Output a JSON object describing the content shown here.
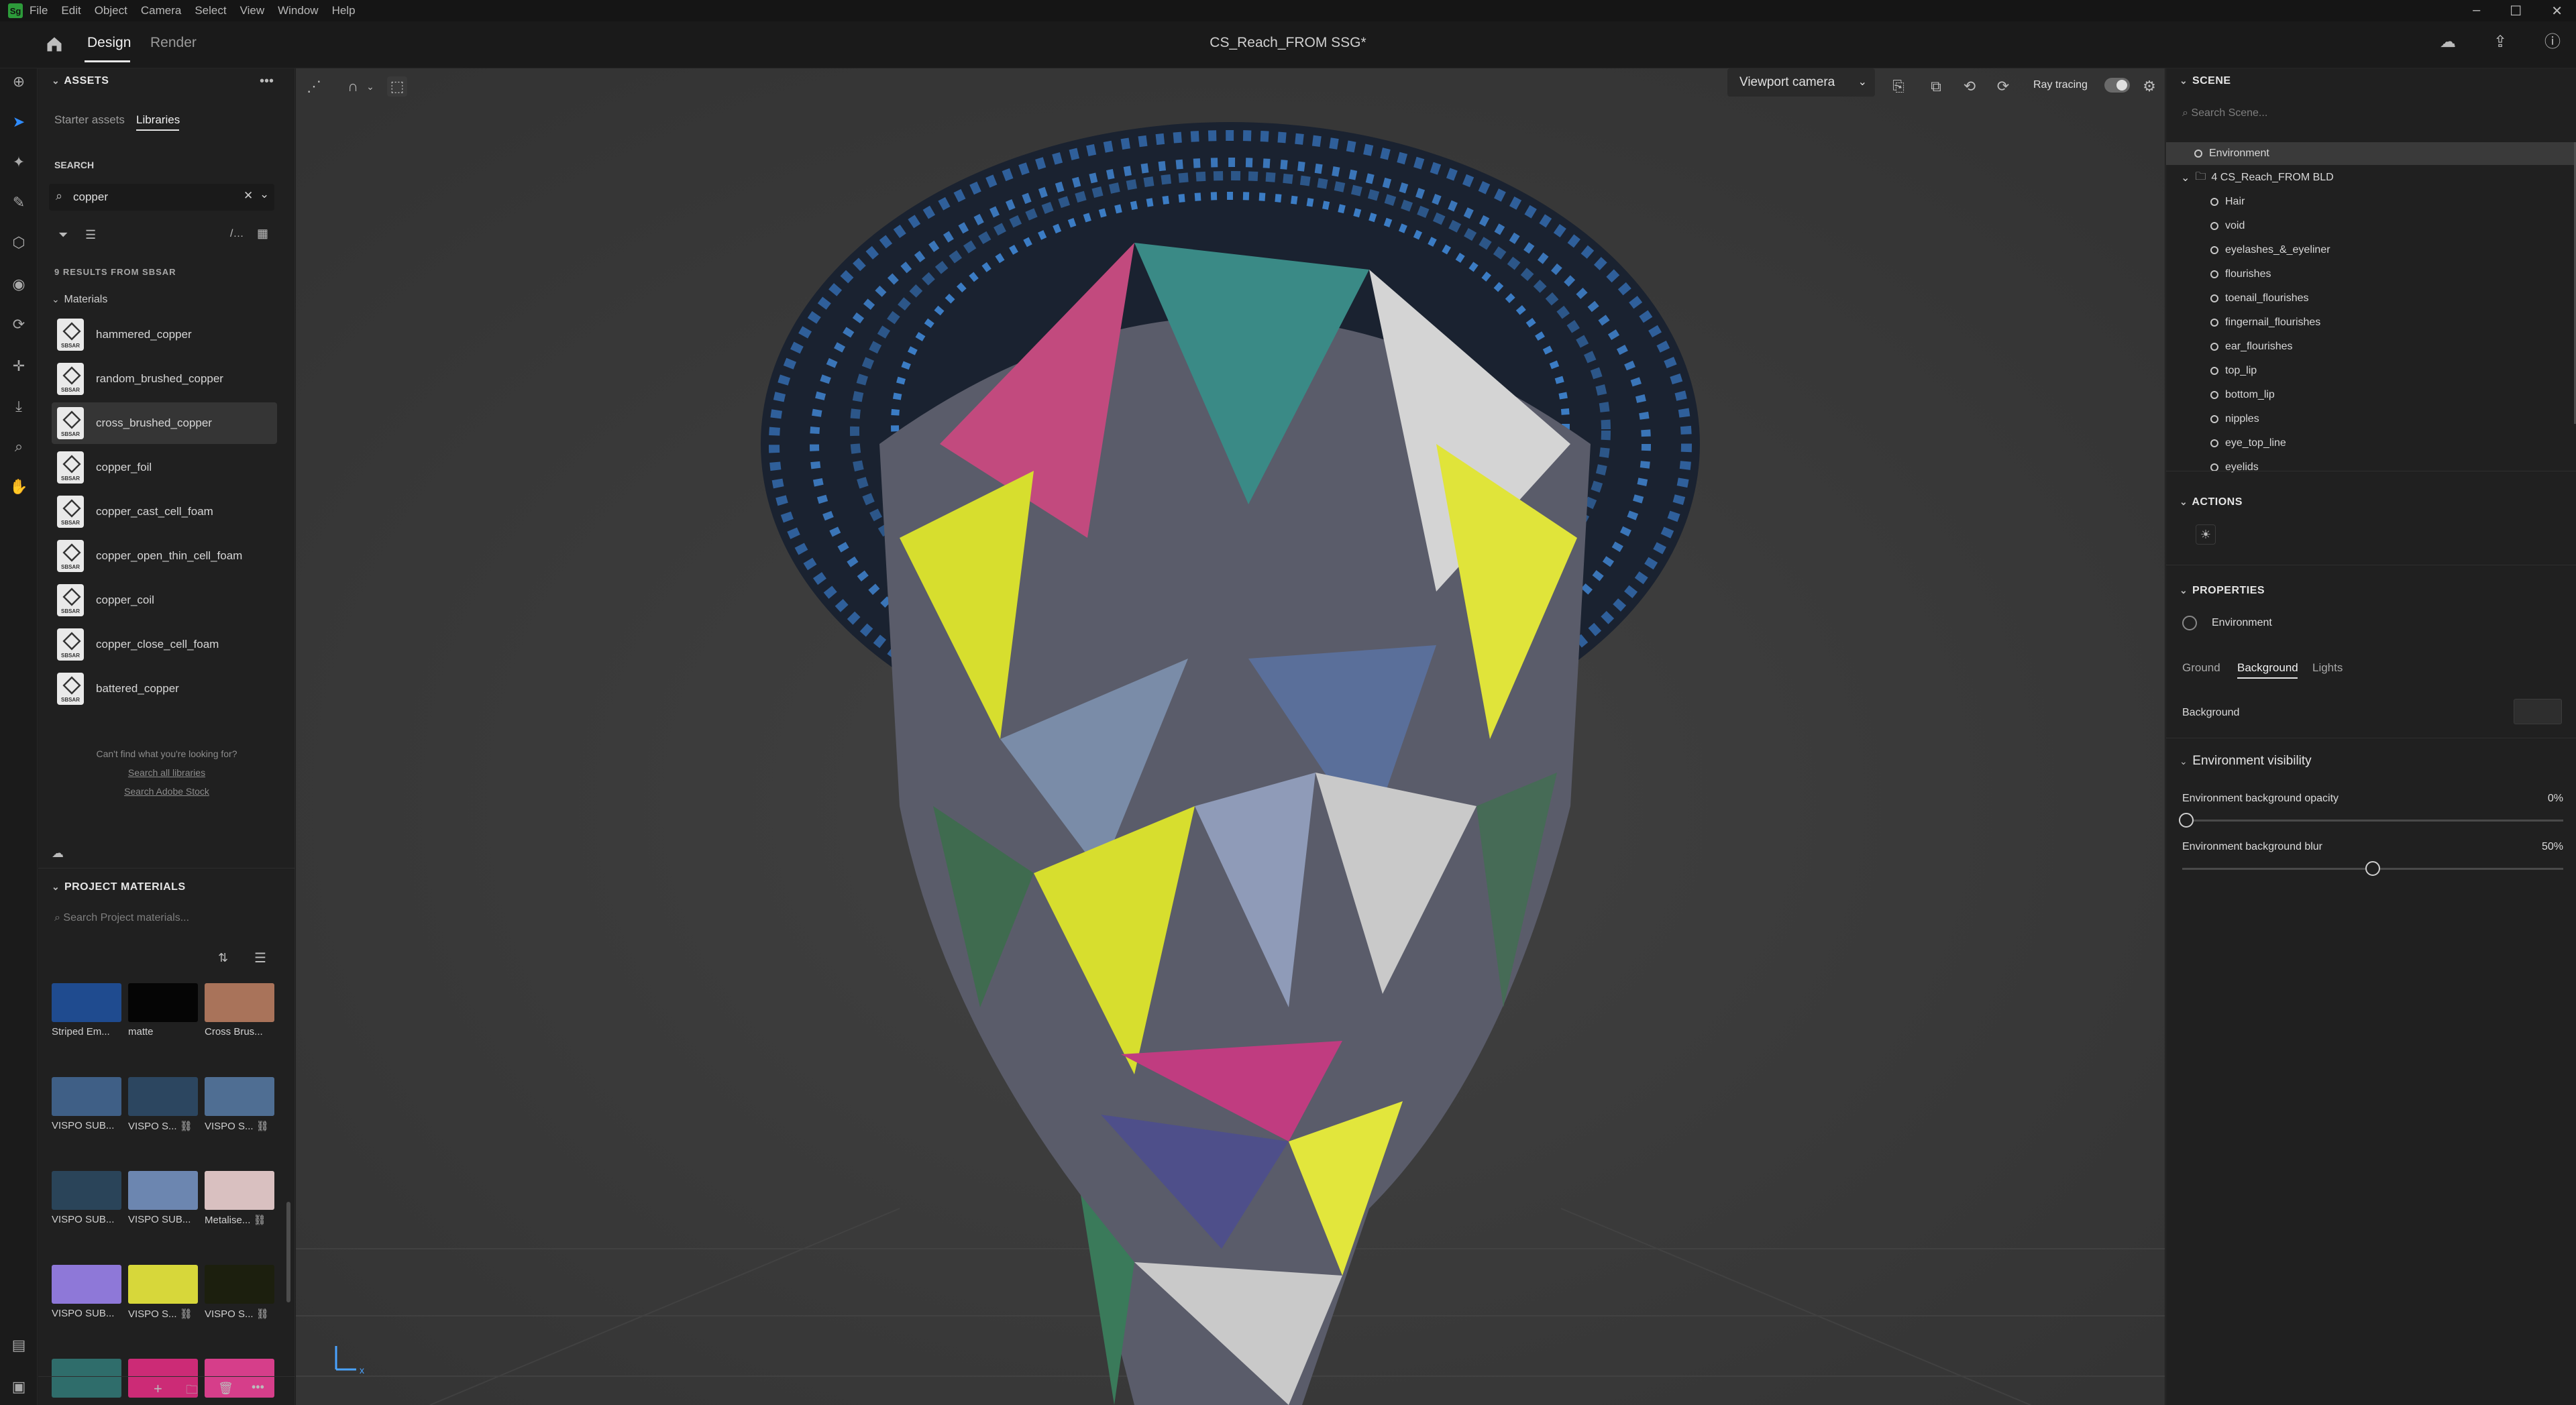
{
  "app": {
    "logo": "Sg",
    "menu": [
      "File",
      "Edit",
      "Object",
      "Camera",
      "Select",
      "View",
      "Window",
      "Help"
    ],
    "modes": [
      "Design",
      "Render"
    ],
    "active_mode": "Design",
    "doc_title": "CS_Reach_FROM SSG*",
    "window_controls": [
      "–",
      "☐",
      "✕"
    ]
  },
  "assets": {
    "header": "ASSETS",
    "tabs": [
      "Starter assets",
      "Libraries"
    ],
    "active_tab": "Libraries",
    "search_label": "SEARCH",
    "search_value": "copper",
    "results_label": "9 RESULTS FROM SBSAR",
    "group_label": "Materials",
    "materials": [
      "hammered_copper",
      "random_brushed_copper",
      "cross_brushed_copper",
      "copper_foil",
      "copper_cast_cell_foam",
      "copper_open_thin_cell_foam",
      "copper_coil",
      "copper_close_cell_foam",
      "battered_copper"
    ],
    "selected_material": "cross_brushed_copper",
    "not_found": "Can't find what you're looking for?",
    "link_all": "Search all libraries",
    "link_stock": "Search Adobe Stock"
  },
  "project_materials": {
    "header": "PROJECT MATERIALS",
    "search_placeholder": "Search Project materials...",
    "items": [
      {
        "label": "Striped Em...",
        "color": "#1f4b8f"
      },
      {
        "label": "matte",
        "color": "#050505"
      },
      {
        "label": "Cross Brus...",
        "color": "#a9735a"
      },
      {
        "label": "VISPO SUB...",
        "color": "#3f5f86"
      },
      {
        "label": "VISPO S... ⛓",
        "color": "#2c4660"
      },
      {
        "label": "VISPO S... ⛓",
        "color": "#4f6e93"
      },
      {
        "label": "VISPO SUB...",
        "color": "#2a4459"
      },
      {
        "label": "VISPO SUB...",
        "color": "#6c86b0"
      },
      {
        "label": "Metalise... ⛓",
        "color": "#d9c0c0"
      },
      {
        "label": "VISPO SUB...",
        "color": "#8e78d8"
      },
      {
        "label": "VISPO S... ⛓",
        "color": "#d7d73a"
      },
      {
        "label": "VISPO S... ⛓",
        "color": "#1c1f0e"
      },
      {
        "label": "",
        "color": "#2f6d6b"
      },
      {
        "label": "",
        "color": "#cc2b76"
      },
      {
        "label": "",
        "color": "#d63e8a"
      }
    ]
  },
  "viewport": {
    "camera": "Viewport camera",
    "ray_tracing": "Ray tracing"
  },
  "scene": {
    "header": "SCENE",
    "search_placeholder": "Search Scene...",
    "items": [
      {
        "label": "Environment",
        "indent": 0
      },
      {
        "label": "4 CS_Reach_FROM BLD",
        "indent": 0
      },
      {
        "label": "Hair",
        "indent": 1
      },
      {
        "label": "void",
        "indent": 1
      },
      {
        "label": "eyelashes_&_eyeliner",
        "indent": 1
      },
      {
        "label": "flourishes",
        "indent": 1
      },
      {
        "label": "toenail_flourishes",
        "indent": 1
      },
      {
        "label": "fingernail_flourishes",
        "indent": 1
      },
      {
        "label": "ear_flourishes",
        "indent": 1
      },
      {
        "label": "top_lip",
        "indent": 1
      },
      {
        "label": "bottom_lip",
        "indent": 1
      },
      {
        "label": "nipples",
        "indent": 1
      },
      {
        "label": "eye_top_line",
        "indent": 1
      },
      {
        "label": "eyelids",
        "indent": 1
      }
    ]
  },
  "actions": {
    "header": "ACTIONS"
  },
  "properties": {
    "header": "PROPERTIES",
    "object": "Environment",
    "tabs": [
      "Ground",
      "Background",
      "Lights"
    ],
    "active_tab": "Background",
    "background_label": "Background",
    "visibility_header": "Environment visibility",
    "opacity_label": "Environment background opacity",
    "opacity_value": "0%",
    "opacity_fraction": 0,
    "blur_label": "Environment background blur",
    "blur_value": "50%",
    "blur_fraction": 0.5
  }
}
